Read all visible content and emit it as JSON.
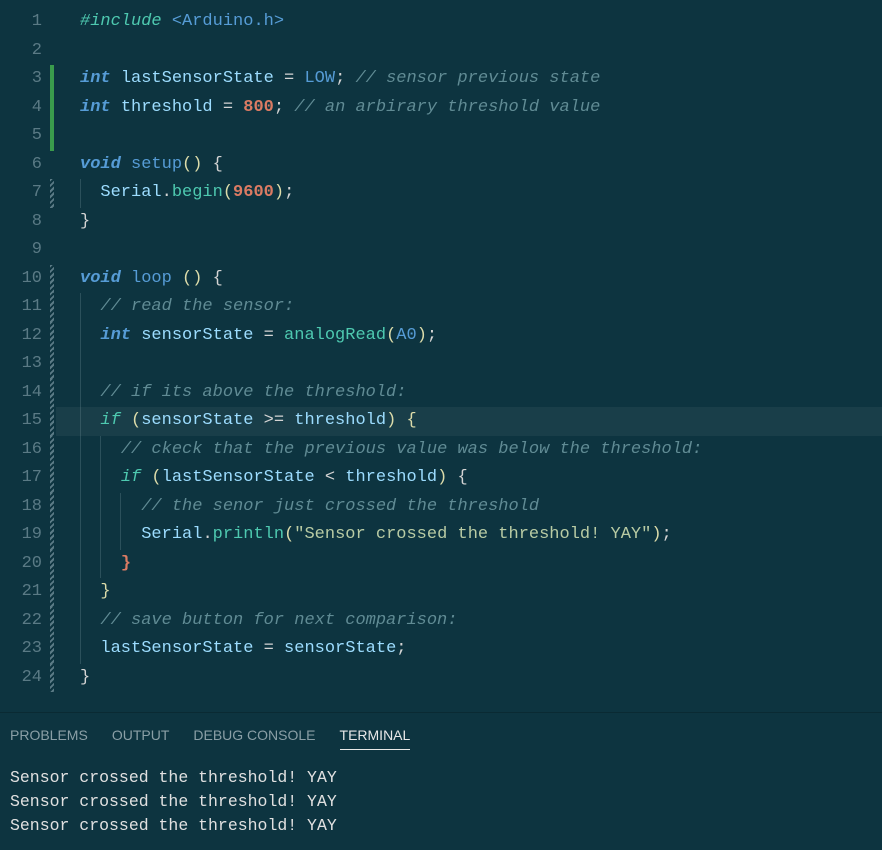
{
  "editor": {
    "lines": [
      {
        "n": 1,
        "margin": ""
      },
      {
        "n": 2,
        "margin": ""
      },
      {
        "n": 3,
        "margin": "green"
      },
      {
        "n": 4,
        "margin": "green"
      },
      {
        "n": 5,
        "margin": "green"
      },
      {
        "n": 6,
        "margin": ""
      },
      {
        "n": 7,
        "margin": "hatch"
      },
      {
        "n": 8,
        "margin": ""
      },
      {
        "n": 9,
        "margin": ""
      },
      {
        "n": 10,
        "margin": "hatch"
      },
      {
        "n": 11,
        "margin": "hatch"
      },
      {
        "n": 12,
        "margin": "hatch"
      },
      {
        "n": 13,
        "margin": "hatch"
      },
      {
        "n": 14,
        "margin": "hatch"
      },
      {
        "n": 15,
        "margin": "hatch",
        "hl": true
      },
      {
        "n": 16,
        "margin": "hatch"
      },
      {
        "n": 17,
        "margin": "hatch"
      },
      {
        "n": 18,
        "margin": "hatch"
      },
      {
        "n": 19,
        "margin": "hatch"
      },
      {
        "n": 20,
        "margin": "hatch"
      },
      {
        "n": 21,
        "margin": "hatch"
      },
      {
        "n": 22,
        "margin": "hatch"
      },
      {
        "n": 23,
        "margin": "hatch"
      },
      {
        "n": 24,
        "margin": "hatch"
      }
    ],
    "tokens": {
      "include": "#include",
      "arduino_h": "<Arduino.h>",
      "int": "int",
      "lastSensorState": "lastSensorState",
      "eq": "=",
      "LOW": "LOW",
      "semi": ";",
      "c_prev_state": "// sensor previous state",
      "threshold": "threshold",
      "n800": "800",
      "c_arbitrary": "// an arbirary threshold value",
      "void": "void",
      "setup": "setup",
      "lp": "(",
      "rp": ")",
      "lb": "{",
      "rb": "}",
      "Serial": "Serial",
      "dot": ".",
      "begin": "begin",
      "n9600": "9600",
      "loop": "loop",
      "c_read": "// read the sensor:",
      "sensorState": "sensorState",
      "analogRead": "analogRead",
      "A0": "A0",
      "c_above": "// if its above the threshold:",
      "if": "if",
      "gte": ">=",
      "c_check": "// ckeck that the previous value was below the threshold:",
      "lt": "<",
      "c_crossed": "// the senor just crossed the threshold",
      "println": "println",
      "str_yay": "\"Sensor crossed the threshold! YAY\"",
      "c_save": "// save button for next comparison:"
    }
  },
  "panel": {
    "tabs": {
      "problems": "PROBLEMS",
      "output": "OUTPUT",
      "debug": "DEBUG CONSOLE",
      "terminal": "TERMINAL"
    },
    "terminal_lines": [
      "Sensor crossed the threshold! YAY",
      "Sensor crossed the threshold! YAY",
      "Sensor crossed the threshold! YAY"
    ]
  }
}
